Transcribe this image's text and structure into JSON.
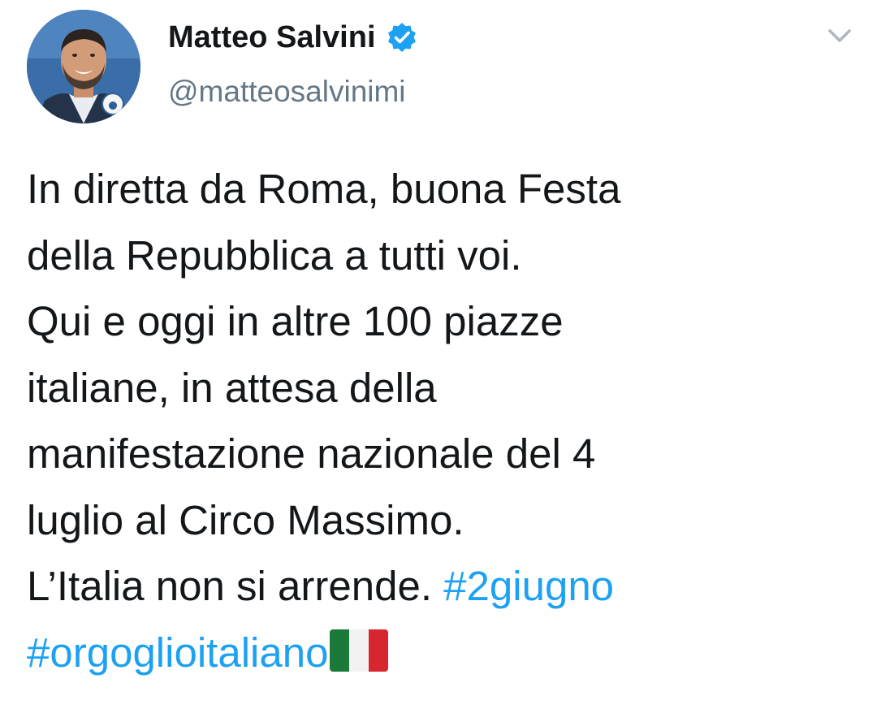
{
  "tweet": {
    "author": {
      "display_name": "Matteo Salvini",
      "handle": "@matteosalvinimi",
      "verified": true,
      "avatar_icon": "profile-photo"
    },
    "menu_icon": "chevron-down-icon",
    "text_lines": [
      "In diretta da Roma, buona Festa",
      "della Repubblica a tutti voi.",
      "Qui e oggi in altre 100 piazze",
      "italiane, in attesa della",
      "manifestazione nazionale del 4",
      "luglio al Circo Massimo.",
      "L’Italia non si arrende."
    ],
    "hashtags": [
      "#2giugno",
      "#orgoglioitaliano"
    ],
    "emoji": "italy-flag",
    "colors": {
      "text": "#14171a",
      "secondary": "#657786",
      "link": "#1da1f2",
      "verified_badge": "#1da1f2"
    }
  }
}
